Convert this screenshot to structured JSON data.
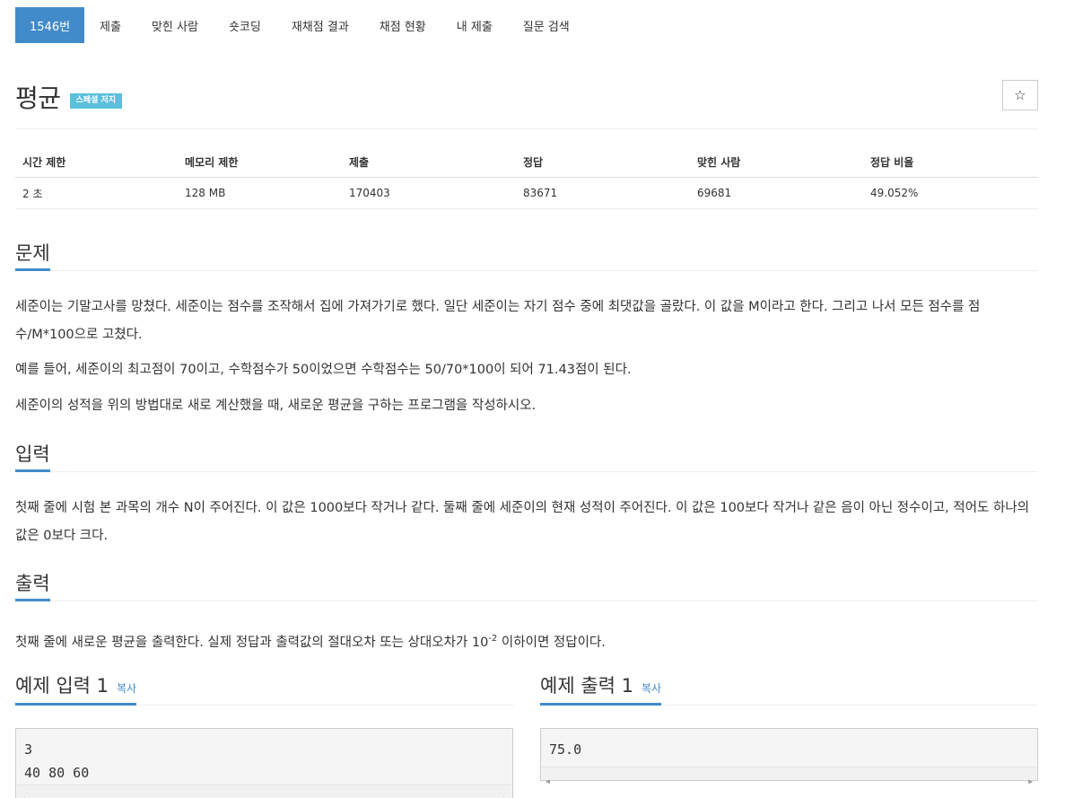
{
  "nav": {
    "items": [
      {
        "label": "1546번",
        "active": true
      },
      {
        "label": "제출"
      },
      {
        "label": "맞힌 사람"
      },
      {
        "label": "숏코딩"
      },
      {
        "label": "재채점 결과"
      },
      {
        "label": "채점 현황"
      },
      {
        "label": "내 제출"
      },
      {
        "label": "질문 검색"
      }
    ]
  },
  "title": {
    "text": "평균",
    "badge": "스페셜 저지",
    "star_glyph": "☆"
  },
  "stats": {
    "headers": [
      "시간 제한",
      "메모리 제한",
      "제출",
      "정답",
      "맞힌 사람",
      "정답 비율"
    ],
    "values": [
      "2 초",
      "128 MB",
      "170403",
      "83671",
      "69681",
      "49.052%"
    ]
  },
  "problem": {
    "heading": "문제",
    "paragraphs": [
      "세준이는 기말고사를 망쳤다. 세준이는 점수를 조작해서 집에 가져가기로 했다. 일단 세준이는 자기 점수 중에 최댓값을 골랐다. 이 값을 M이라고 한다. 그리고 나서 모든 점수를 점수/M*100으로 고쳤다.",
      "예를 들어, 세준이의 최고점이 70이고, 수학점수가 50이었으면 수학점수는 50/70*100이 되어 71.43점이 된다.",
      "세준이의 성적을 위의 방법대로 새로 계산했을 때, 새로운 평균을 구하는 프로그램을 작성하시오."
    ]
  },
  "input": {
    "heading": "입력",
    "text": "첫째 줄에 시험 본 과목의 개수 N이 주어진다. 이 값은 1000보다 작거나 같다. 둘째 줄에 세준이의 현재 성적이 주어진다. 이 값은 100보다 작거나 같은 음이 아닌 정수이고, 적어도 하나의 값은 0보다 크다."
  },
  "output": {
    "heading": "출력",
    "text_before": "첫째 줄에 새로운 평균을 출력한다. 실제 정답과 출력값의 절대오차 또는 상대오차가 10",
    "exponent": "-2",
    "text_after": " 이하이면 정답이다."
  },
  "examples": {
    "input": {
      "title": "예제 입력 1",
      "copy": "복사",
      "content": "3\n40 80 60"
    },
    "output": {
      "title": "예제 출력 1",
      "copy": "복사",
      "content": "75.0"
    }
  }
}
